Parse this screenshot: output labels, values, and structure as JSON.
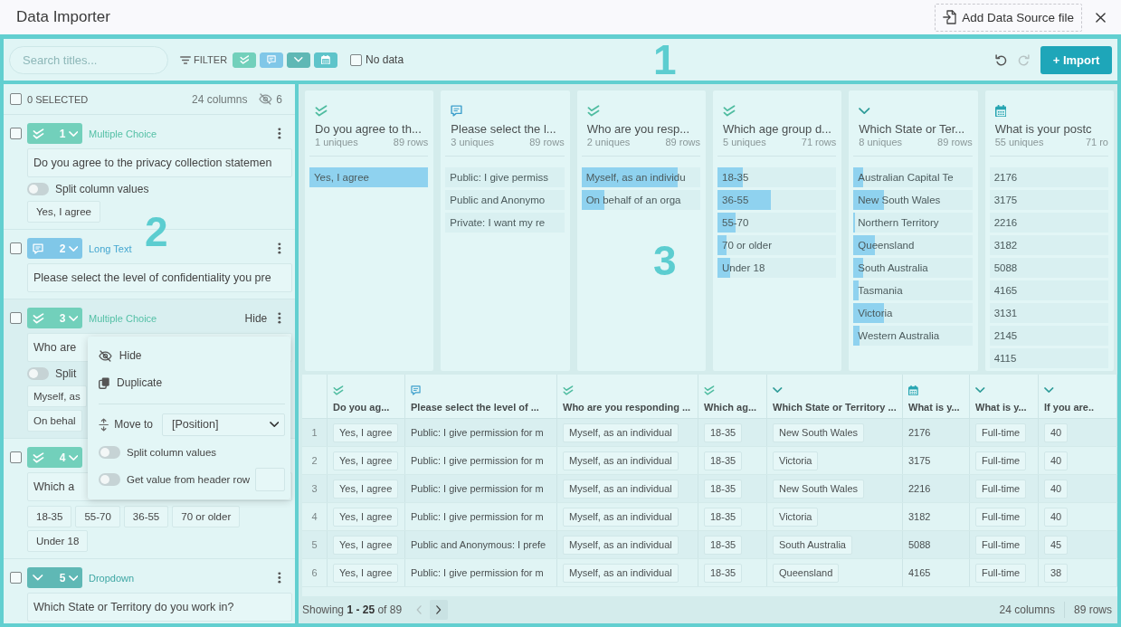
{
  "window": {
    "title": "Data Importer",
    "add_source_button": "Add Data Source file"
  },
  "toolbar": {
    "callout": "1",
    "search": {
      "placeholder": "Search titles..."
    },
    "filter_label": "FILTER",
    "filters": [
      {
        "kind": "multiple_choice",
        "selected": true
      },
      {
        "kind": "long_text",
        "selected": true
      },
      {
        "kind": "dropdown",
        "selected": true
      },
      {
        "kind": "date",
        "selected": true
      }
    ],
    "no_data": {
      "label": "No data",
      "checked": false
    },
    "undo": {
      "disabled": false
    },
    "redo": {
      "disabled": true
    },
    "import_button": "+ Import"
  },
  "column_list": {
    "callout": "2",
    "select_all": {
      "label": "0 SELECTED",
      "checked": false
    },
    "column_count": "24 columns",
    "hidden_count": "6",
    "columns": [
      {
        "kind": "multiple_choice",
        "number": "1",
        "type_label": "Multiple Choice",
        "more_button": true,
        "checked": false,
        "title": "Do you agree to the privacy collection statemen",
        "split": {
          "label": "Split column values",
          "on": false
        },
        "values": [
          "Yes, I agree"
        ]
      },
      {
        "kind": "long_text",
        "number": "2",
        "type_label": "Long Text",
        "more_button": true,
        "checked": false,
        "title": "Please select the level of confidentiality you pre"
      },
      {
        "kind": "multiple_choice",
        "number": "3",
        "type_label": "Multiple Choice",
        "hover_action": "Hide",
        "more_button": true,
        "checked": false,
        "title": "Who are",
        "split": {
          "label": "Split",
          "on": false
        },
        "values": [
          "Myself, as",
          "On behal"
        ],
        "menu": {
          "actions": [
            {
              "kind": "hide",
              "label": "Hide"
            },
            {
              "kind": "duplicate",
              "label": "Duplicate"
            }
          ],
          "move_to": {
            "label": "Move to",
            "value": "[Position]"
          },
          "toggles": [
            {
              "kind": "plain",
              "label": "Split column values",
              "on": false
            },
            {
              "kind": "with_field",
              "label": "Get value from header row",
              "on": false
            }
          ]
        }
      },
      {
        "kind": "multiple_choice",
        "number": "4",
        "more_button": false,
        "checked": false,
        "title": "Which a",
        "values": [
          "18-35",
          "55-70",
          "36-55",
          "70 or older",
          "Under 18"
        ]
      },
      {
        "kind": "dropdown",
        "number": "5",
        "type_label": "Dropdown",
        "more_button": true,
        "checked": false,
        "title": "Which State or Territory do you work in?"
      }
    ]
  },
  "preview": {
    "callout": "3",
    "cards": [
      {
        "kind": "multiple_choice",
        "title": "Do you agree to th...",
        "uniques": "1 uniques",
        "rows": "89 rows",
        "values": [
          {
            "label": "Yes, I agree",
            "level": 1
          }
        ]
      },
      {
        "kind": "long_text",
        "title": "Please select the l...",
        "uniques": "3 uniques",
        "rows": "89 rows",
        "values": [
          {
            "label": "Public: I give permiss"
          },
          {
            "label": "Public and Anonymo"
          },
          {
            "label": "Private: I want my re"
          }
        ]
      },
      {
        "kind": "multiple_choice",
        "title": "Who are you resp...",
        "uniques": "2 uniques",
        "rows": "89 rows",
        "values": [
          {
            "label": "Myself, as an individu",
            "level": 0.81
          },
          {
            "label": "On behalf of an orga",
            "level": 0.19
          }
        ]
      },
      {
        "kind": "multiple_choice",
        "title": "Which age group d...",
        "uniques": "5 uniques",
        "rows": "71 rows",
        "values": [
          {
            "label": "18-35",
            "level": 0.21
          },
          {
            "label": "36-55",
            "level": 0.45
          },
          {
            "label": "55-70",
            "level": 0.15
          },
          {
            "label": "70 or older",
            "level": 0.08
          },
          {
            "label": "Under 18",
            "level": 0.11
          }
        ]
      },
      {
        "kind": "dropdown",
        "title": "Which State or Ter...",
        "uniques": "8 uniques",
        "rows": "89 rows",
        "values": [
          {
            "label": "Australian Capital Te",
            "level": 0.08
          },
          {
            "label": "New South Wales",
            "level": 0.26
          },
          {
            "label": "Northern Territory",
            "level": 0.01
          },
          {
            "label": "Queensland",
            "level": 0.18
          },
          {
            "label": "South Australia",
            "level": 0.08
          },
          {
            "label": "Tasmania",
            "level": 0.04
          },
          {
            "label": "Victoria",
            "level": 0.26
          },
          {
            "label": "Western Australia",
            "level": 0.05
          }
        ]
      },
      {
        "kind": "date",
        "title": "What is your postc",
        "uniques": "55 uniques",
        "rows": "71 ro",
        "values": [
          {
            "label": "2176"
          },
          {
            "label": "3175"
          },
          {
            "label": "2216"
          },
          {
            "label": "3182"
          },
          {
            "label": "5088"
          },
          {
            "label": "4165"
          },
          {
            "label": "3131"
          },
          {
            "label": "2145"
          },
          {
            "label": "4115"
          }
        ]
      }
    ],
    "table": {
      "columns": [
        {
          "kind": "multiple_choice",
          "label": "Do you ag..."
        },
        {
          "kind": "long_text",
          "label": "Please select the level of ..."
        },
        {
          "kind": "multiple_choice",
          "label": "Who are you responding ..."
        },
        {
          "kind": "multiple_choice",
          "label": "Which ag..."
        },
        {
          "kind": "dropdown",
          "label": "Which State or Territory ..."
        },
        {
          "kind": "date",
          "label": "What is y..."
        },
        {
          "kind": "dropdown",
          "label": "What is y..."
        },
        {
          "kind": "dropdown",
          "label": "If you are.."
        }
      ],
      "rows": [
        {
          "number": "1",
          "cells": [
            "Yes, I agree",
            "Public: I give permission for m",
            "Myself, as an individual",
            "18-35",
            "New South Wales",
            "2176",
            "Full-time",
            "40"
          ]
        },
        {
          "number": "2",
          "cells": [
            "Yes, I agree",
            "Public: I give permission for m",
            "Myself, as an individual",
            "18-35",
            "Victoria",
            "3175",
            "Full-time",
            "40"
          ]
        },
        {
          "number": "3",
          "cells": [
            "Yes, I agree",
            "Public: I give permission for m",
            "Myself, as an individual",
            "18-35",
            "New South Wales",
            "2216",
            "Full-time",
            "40"
          ]
        },
        {
          "number": "4",
          "cells": [
            "Yes, I agree",
            "Public: I give permission for m",
            "Myself, as an individual",
            "18-35",
            "Victoria",
            "3182",
            "Full-time",
            "40"
          ]
        },
        {
          "number": "5",
          "cells": [
            "Yes, I agree",
            "Public and Anonymous: I prefe",
            "Myself, as an individual",
            "18-35",
            "South Australia",
            "5088",
            "Full-time",
            "45"
          ]
        },
        {
          "number": "6",
          "cells": [
            "Yes, I agree",
            "Public: I give permission for m",
            "Myself, as an individual",
            "18-35",
            "Queensland",
            "4165",
            "Full-time",
            "38"
          ]
        }
      ]
    },
    "footer": {
      "summary": "Showing **1 - 25** of 89",
      "previous": {
        "disabled": true
      },
      "next": {
        "disabled": false
      },
      "column_count": "24 columns",
      "row_count": "89 rows"
    }
  }
}
